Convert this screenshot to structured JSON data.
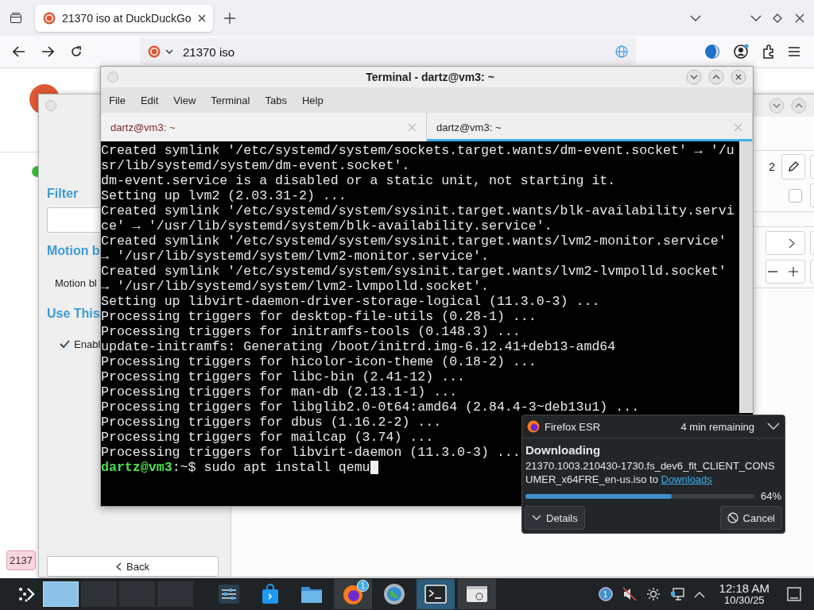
{
  "browser": {
    "tabs": [
      {
        "title": "21370 iso at DuckDuckGo",
        "selected": true
      }
    ],
    "address": "21370 iso",
    "page": {
      "chip": "2137"
    }
  },
  "settings_window": {
    "sidebar": {
      "heading_1": "Filter",
      "heading_2": "Motion b",
      "option_label": "Motion bl",
      "heading_3": "Use This",
      "checkbox": {
        "label": "Enabl",
        "checked": true
      },
      "back_button": "Back"
    },
    "content": {
      "number_field": "2",
      "checkbox": {
        "checked": false
      }
    }
  },
  "terminal": {
    "title": "Terminal - dartz@vm3: ~",
    "menu": [
      "File",
      "Edit",
      "View",
      "Terminal",
      "Tabs",
      "Help"
    ],
    "tabs": [
      {
        "title": "dartz@vm3: ~",
        "selected": false
      },
      {
        "title": "dartz@vm3: ~",
        "selected": true
      }
    ],
    "lines": [
      "Created symlink '/etc/systemd/system/sockets.target.wants/dm-event.socket' → '/u",
      "sr/lib/systemd/system/dm-event.socket'.",
      "dm-event.service is a disabled or a static unit, not starting it.",
      "Setting up lvm2 (2.03.31-2) ...",
      "Created symlink '/etc/systemd/system/sysinit.target.wants/blk-availability.servi",
      "ce' → '/usr/lib/systemd/system/blk-availability.service'.",
      "Created symlink '/etc/systemd/system/sysinit.target.wants/lvm2-monitor.service'",
      "→ '/usr/lib/systemd/system/lvm2-monitor.service'.",
      "Created symlink '/etc/systemd/system/sysinit.target.wants/lvm2-lvmpolld.socket'",
      "→ '/usr/lib/systemd/system/lvm2-lvmpolld.socket'.",
      "Setting up libvirt-daemon-driver-storage-logical (11.3.0-3) ...",
      "Processing triggers for desktop-file-utils (0.28-1) ...",
      "Processing triggers for initramfs-tools (0.148.3) ...",
      "update-initramfs: Generating /boot/initrd.img-6.12.41+deb13-amd64",
      "Processing triggers for hicolor-icon-theme (0.18-2) ...",
      "Processing triggers for libc-bin (2.41-12) ...",
      "Processing triggers for man-db (2.13.1-1) ...",
      "Processing triggers for libglib2.0-0t64:amd64 (2.84.4-3~deb13u1) ...",
      "Processing triggers for dbus (1.16.2-2) ...",
      "Processing triggers for mailcap (3.74) ...",
      "Processing triggers for libvirt-daemon (11.3.0-3) ..."
    ],
    "prompt": {
      "user": "dartz@vm3",
      "path": ":~$ ",
      "command": "sudo apt install qemu"
    }
  },
  "download": {
    "app": "Firefox ESR",
    "remaining": "4 min remaining",
    "heading": "Downloading",
    "file": "21370.1003.210430-1730.fs_dev6_flt_CLIENT_CONSUMER_x64FRE_en-us.iso to",
    "link": "Downloads",
    "level": 0.64,
    "percent": "64%",
    "details_button": "Details",
    "cancel_button": "Cancel"
  },
  "taskbar": {
    "pager": [
      {
        "selected": true
      },
      {
        "selected": false
      },
      {
        "selected": false
      },
      {
        "selected": false
      }
    ],
    "apps": [
      {
        "kind": "sliders",
        "open": false,
        "active": false
      },
      {
        "kind": "store",
        "open": false,
        "active": false
      },
      {
        "kind": "folder",
        "open": false,
        "active": false
      },
      {
        "kind": "firefox",
        "open": true,
        "active": false,
        "badge": "1"
      },
      {
        "kind": "globe",
        "open": false,
        "active": false
      },
      {
        "kind": "terminal",
        "open": true,
        "active": true
      },
      {
        "kind": "window",
        "open": true,
        "active": false
      }
    ],
    "update_badge": "1",
    "time": "12:18 AM",
    "date": "10/30/25"
  }
}
